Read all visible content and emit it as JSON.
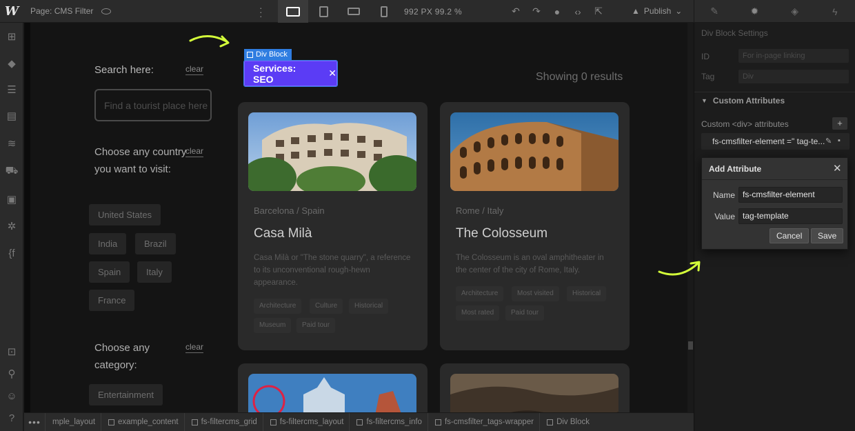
{
  "topbar": {
    "logo": "W",
    "page_label": "Page: CMS Filter",
    "kebab": "⋮",
    "viewport": "992 PX  99.2 %",
    "publish_label": "Publish",
    "icons": [
      "undo-icon",
      "redo-icon",
      "comment-icon",
      "code-icon",
      "export-icon"
    ],
    "panel_tabs": [
      "style-brush-icon",
      "settings-gear-icon",
      "interactions-icon",
      "lightning-icon"
    ]
  },
  "left_toolbar": [
    "add-icon",
    "components-icon",
    "navigator-icon",
    "pages-icon",
    "cms-icon",
    "ecommerce-icon",
    "assets-icon",
    "settings-icon",
    "finsweet-icon",
    "preview-icon",
    "search-icon",
    "users-icon",
    "help-icon"
  ],
  "canvas": {
    "search_label": "Search here:",
    "clear_label": "clear",
    "search_placeholder": "Find a tourist place here",
    "country_heading": "Choose any country you want to visit:",
    "countries": [
      "United States",
      "India",
      "Brazil",
      "Spain",
      "Italy",
      "France"
    ],
    "category_heading": "Choose any category:",
    "categories": [
      "Entertainment"
    ],
    "showing": "Showing 0 results",
    "selected_element_label": "Div Block",
    "seo_tag": "Services: SEO",
    "cards": [
      {
        "city": "Barcelona",
        "country": "Spain",
        "title": "Casa Milà",
        "description": "Casa Milà or \"The stone quarry\", a reference to its unconventional rough-hewn appearance.",
        "tags": [
          "Architecture",
          "Culture",
          "Historical",
          "Museum",
          "Paid tour"
        ]
      },
      {
        "city": "Rome",
        "country": "Italy",
        "title": "The Colosseum",
        "description": "The Colosseum is an oval amphitheater in the center of the city of Rome, Italy.",
        "tags": [
          "Architecture",
          "Most visited",
          "Historical",
          "Most rated",
          "Paid tour"
        ]
      }
    ]
  },
  "right_panel": {
    "header": "Div Block Settings",
    "id_label": "ID",
    "id_placeholder": "For in-page linking",
    "tag_label": "Tag",
    "tag_value": "Div",
    "section_title": "Custom Attributes",
    "custom_attr_label": "Custom <div> attributes",
    "attr_row": "fs-cmsfilter-element =\" tag-te...",
    "add_button": "+"
  },
  "dialog": {
    "title": "Add Attribute",
    "name_label": "Name",
    "name_value": "fs-cmsfilter-element",
    "value_label": "Value",
    "value_value": "tag-template",
    "cancel_label": "Cancel",
    "save_label": "Save"
  },
  "breadcrumbs": [
    "mple_layout",
    "example_content",
    "fs-filtercms_grid",
    "fs-filtercms_layout",
    "fs-filtercms_info",
    "fs-cmsfilter_tags-wrapper",
    "Div Block"
  ],
  "colors": {
    "accent": "#2f7de1",
    "seo_tag": "#5b3cf5",
    "arrow": "#d4ff3a"
  }
}
